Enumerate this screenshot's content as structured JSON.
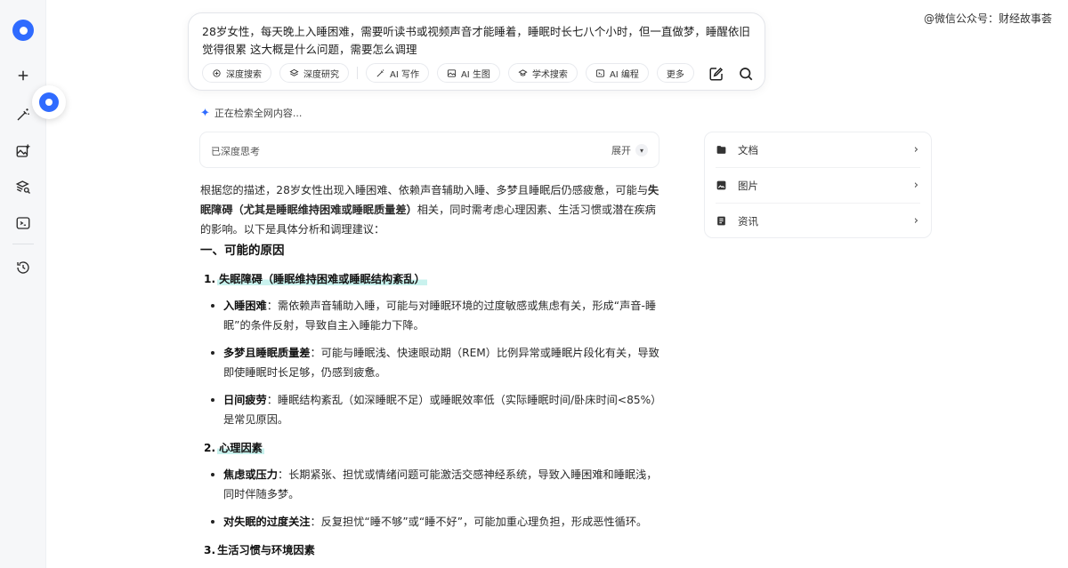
{
  "watermark": "@微信公众号：财经故事荟",
  "query": {
    "text": "28岁女性，每天晚上入睡困难，需要听读书或视频声音才能睡着，睡眠时长七八个小时，但一直做梦，睡醒依旧觉得很累 这大概是什么问题，需要怎么调理"
  },
  "tools": [
    {
      "label": "深度搜索",
      "icon": "deep-search-icon"
    },
    {
      "label": "深度研究",
      "icon": "deep-research-icon"
    },
    {
      "label": "AI 写作",
      "icon": "ai-write-icon"
    },
    {
      "label": "AI 生图",
      "icon": "ai-image-icon"
    },
    {
      "label": "学术搜索",
      "icon": "academic-search-icon"
    },
    {
      "label": "AI 编程",
      "icon": "ai-code-icon"
    },
    {
      "label": "更多",
      "icon": ""
    }
  ],
  "status": "正在检索全网内容...",
  "thinking": {
    "label": "已深度思考",
    "expand": "展开"
  },
  "answer": {
    "intro_a": "根据您的描述，28岁女性出现入睡困难、依赖声音辅助入睡、多梦且睡眠后仍感疲惫，可能与",
    "intro_bold": "失眠障碍（尤其是睡眠维持困难或睡眠质量差）",
    "intro_b": "相关，同时需考虑心理因素、生活习惯或潜在疾病的影响。以下是具体分析和调理建议：",
    "heading1": "一、可能的原因",
    "sections": [
      {
        "num": "1.",
        "title": "失眠障碍（睡眠维持困难或睡眠结构紊乱）",
        "bullets": [
          {
            "bold": "入睡困难",
            "text": "：需依赖声音辅助入睡，可能与对睡眠环境的过度敏感或焦虑有关，形成“声音-睡眠”的条件反射，导致自主入睡能力下降。"
          },
          {
            "bold": "多梦且睡眠质量差",
            "text": "：可能与睡眠浅、快速眼动期（REM）比例异常或睡眠片段化有关，导致即使睡眠时长足够，仍感到疲惫。"
          },
          {
            "bold": "日间疲劳",
            "text": "：睡眠结构紊乱（如深睡眠不足）或睡眠效率低（实际睡眠时间/卧床时间<85%）是常见原因。"
          }
        ]
      },
      {
        "num": "2.",
        "title": "心理因素",
        "bullets": [
          {
            "bold": "焦虑或压力",
            "text": "：长期紧张、担忧或情绪问题可能激活交感神经系统，导致入睡困难和睡眠浅，同时伴随多梦。"
          },
          {
            "bold": "对失眠的过度关注",
            "text": "：反复担忧“睡不够”或“睡不好”，可能加重心理负担，形成恶性循环。"
          }
        ]
      },
      {
        "num": "3.",
        "title": "生活习惯与环境因素",
        "bullets": []
      }
    ]
  },
  "side": {
    "items": [
      {
        "label": "文档",
        "icon": "folder-icon"
      },
      {
        "label": "图片",
        "icon": "image-icon"
      },
      {
        "label": "资讯",
        "icon": "news-icon"
      }
    ]
  }
}
